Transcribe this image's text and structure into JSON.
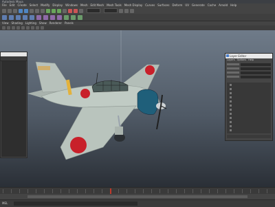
{
  "window": {
    "title": "Autodesk Maya",
    "controls": [
      "–",
      "□",
      "✕"
    ]
  },
  "menubar": {
    "items": [
      "File",
      "Edit",
      "Create",
      "Select",
      "Modify",
      "Display",
      "Windows",
      "Mesh",
      "Edit Mesh",
      "Mesh Tools",
      "Mesh Display",
      "Curves",
      "Surfaces",
      "Deform",
      "UV",
      "Generate",
      "Cache",
      "Arnold",
      "Help"
    ]
  },
  "viewport_menu": {
    "items": [
      "View",
      "Shading",
      "Lighting",
      "Show",
      "Renderer",
      "Panels"
    ]
  },
  "panel": {
    "title": "Layer Editor",
    "menu": [
      "Layers",
      "Options",
      "Help"
    ]
  },
  "cmdline": {
    "label": "MEL"
  },
  "colors": {
    "ui_dark": "#444444",
    "plane_body": "#b9c4bd",
    "hinomaru_red": "#c8202a",
    "cowling_teal": "#1f5f7a",
    "accent_blue": "#4a7ec9"
  }
}
